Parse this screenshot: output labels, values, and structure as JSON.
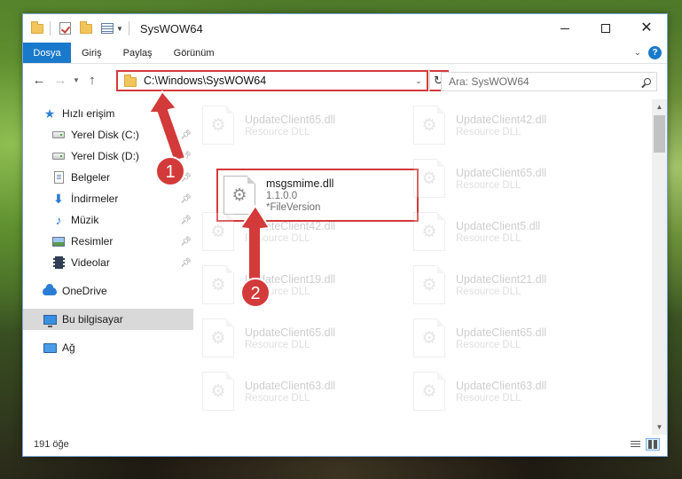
{
  "window": {
    "title": "SysWOW64"
  },
  "ribbon": {
    "tabs": [
      "Dosya",
      "Giriş",
      "Paylaş",
      "Görünüm"
    ]
  },
  "address": {
    "path": "C:\\Windows\\SysWOW64"
  },
  "search": {
    "placeholder": "Ara: SysWOW64"
  },
  "sidebar": {
    "items": [
      {
        "label": "Hızlı erişim",
        "icon": "star-icon"
      },
      {
        "label": "Yerel Disk (C:)",
        "icon": "drive-icon"
      },
      {
        "label": "Yerel Disk (D:)",
        "icon": "drive-icon"
      },
      {
        "label": "Belgeler",
        "icon": "documents-icon"
      },
      {
        "label": "İndirmeler",
        "icon": "download-icon"
      },
      {
        "label": "Müzik",
        "icon": "music-icon"
      },
      {
        "label": "Resimler",
        "icon": "pictures-icon"
      },
      {
        "label": "Videolar",
        "icon": "videos-icon"
      },
      {
        "label": "OneDrive",
        "icon": "onedrive-icon"
      },
      {
        "label": "Bu bilgisayar",
        "icon": "computer-icon"
      },
      {
        "label": "Ağ",
        "icon": "network-icon"
      }
    ]
  },
  "files": [
    {
      "name": "UpdateClient65.dll",
      "sub": "Resource DLL",
      "version": ""
    },
    {
      "name": "UpdateClient42.dll",
      "sub": "Resource DLL",
      "version": ""
    },
    {
      "name": "msgsmime.dll",
      "sub": "1.1.0.0",
      "version": "*FileVersion"
    },
    {
      "name": "UpdateClient65.dll",
      "sub": "Resource DLL",
      "version": ""
    },
    {
      "name": "UpdateClient42.dll",
      "sub": "Resource DLL",
      "version": ""
    },
    {
      "name": "UpdateClient5.dll",
      "sub": "Resource DLL",
      "version": ""
    },
    {
      "name": "UpdateClient19.dll",
      "sub": "Resource DLL",
      "version": ""
    },
    {
      "name": "UpdateClient21.dll",
      "sub": "Resource DLL",
      "version": ""
    },
    {
      "name": "UpdateClient65.dll",
      "sub": "Resource DLL",
      "version": ""
    },
    {
      "name": "UpdateClient65.dll",
      "sub": "Resource DLL",
      "version": ""
    },
    {
      "name": "UpdateClient63.dll",
      "sub": "Resource DLL",
      "version": ""
    },
    {
      "name": "UpdateClient63.dll",
      "sub": "Resource DLL",
      "version": ""
    }
  ],
  "status": {
    "count": "191 öğe"
  },
  "annotations": {
    "step1": "1",
    "step2": "2",
    "color": "#d33a3a"
  }
}
